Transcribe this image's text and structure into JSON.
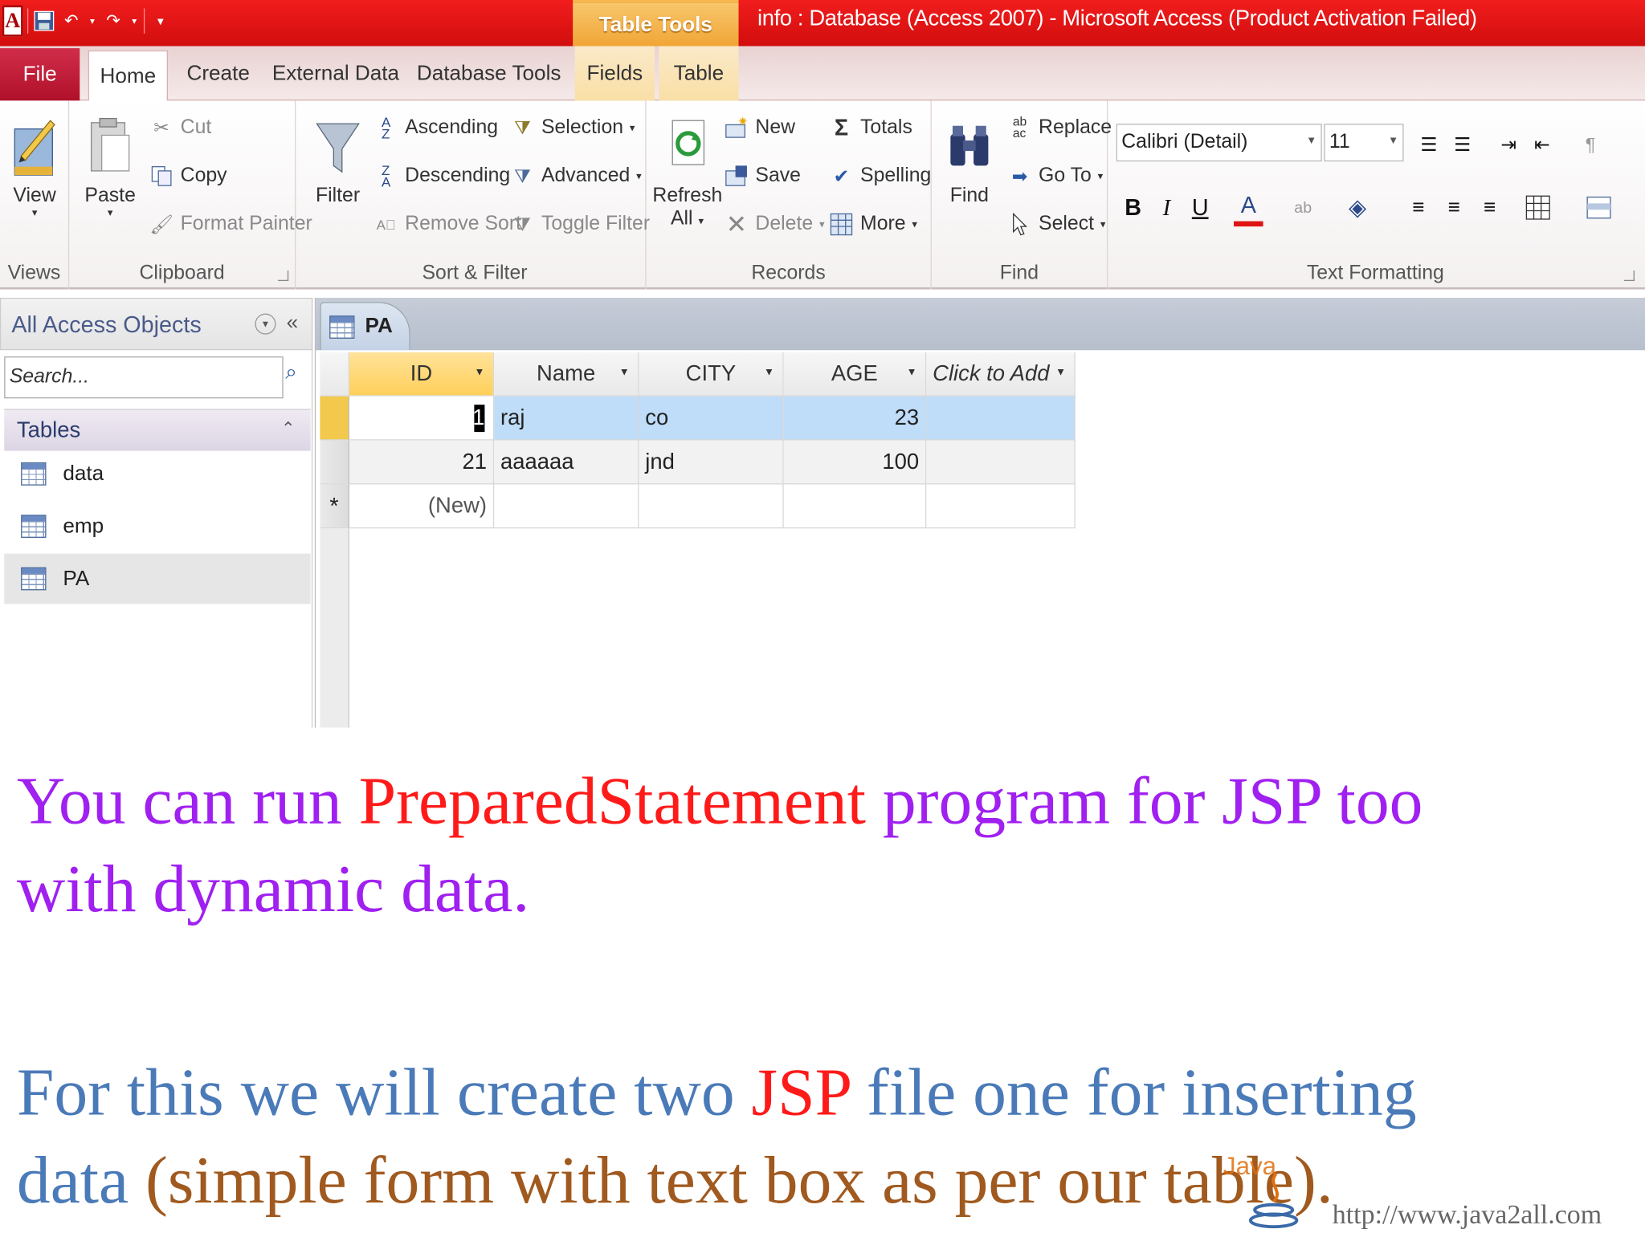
{
  "titlebar": {
    "app_letter": "A",
    "context_tab": "Table Tools",
    "window_title": "info : Database (Access 2007)  -  Microsoft Access (Product Activation Failed)"
  },
  "tabs": {
    "file": "File",
    "home": "Home",
    "create": "Create",
    "external_data": "External Data",
    "database_tools": "Database Tools",
    "fields": "Fields",
    "table": "Table"
  },
  "ribbon": {
    "views": {
      "label": "Views",
      "view": "View"
    },
    "clipboard": {
      "label": "Clipboard",
      "paste": "Paste",
      "cut": "Cut",
      "copy": "Copy",
      "format_painter": "Format Painter"
    },
    "sort_filter": {
      "label": "Sort & Filter",
      "filter": "Filter",
      "ascending": "Ascending",
      "descending": "Descending",
      "remove_sort": "Remove Sort",
      "selection": "Selection",
      "advanced": "Advanced",
      "toggle_filter": "Toggle Filter"
    },
    "records": {
      "label": "Records",
      "refresh": "Refresh",
      "refresh_all": "All",
      "new": "New",
      "save": "Save",
      "delete": "Delete",
      "totals": "Totals",
      "spelling": "Spelling",
      "more": "More"
    },
    "find": {
      "label": "Find",
      "find": "Find",
      "replace": "Replace",
      "go_to": "Go To",
      "select": "Select"
    },
    "text_formatting": {
      "label": "Text Formatting",
      "font": "Calibri (Detail)",
      "size": "11"
    }
  },
  "nav": {
    "title": "All Access Objects",
    "search_placeholder": "Search...",
    "group": "Tables",
    "items": [
      "data",
      "emp",
      "PA"
    ]
  },
  "doc": {
    "tab": "PA",
    "columns": [
      "ID",
      "Name",
      "CITY",
      "AGE",
      "Click to Add"
    ],
    "rows": [
      {
        "id": "1",
        "name": "raj",
        "city": "co",
        "age": "23"
      },
      {
        "id": "21",
        "name": "aaaaaa",
        "city": "jnd",
        "age": "100"
      }
    ],
    "new_row_marker": "*",
    "new_row_label": "(New)"
  },
  "slide": {
    "line1_a": "You can run ",
    "line1_b": "PreparedStatement",
    "line1_c": " program for JSP too",
    "line2": "with dynamic data.",
    "line3_a": "For this we will create two ",
    "line3_b": "JSP",
    "line3_c": " file one for inserting",
    "line4_a": "data ",
    "line4_b": "(simple form with text box as per our table).",
    "watermark": "http://www.java2all.com"
  },
  "colors": {
    "titlebar": "#e01414",
    "context_tab": "#f0a434",
    "purple_text": "#a020f0",
    "red_text": "#ff1a1a",
    "blue_text": "#4a7ab8",
    "brown_text": "#a0591e"
  }
}
